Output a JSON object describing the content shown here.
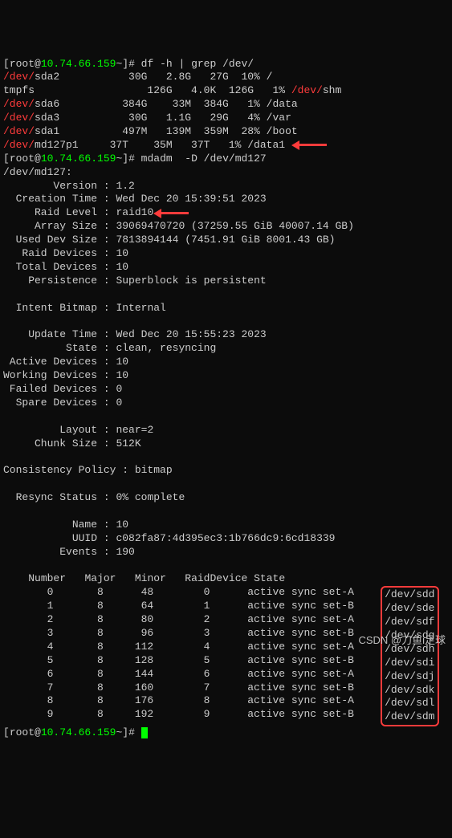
{
  "prompt": {
    "userhost": "root@",
    "ip": "10.74.66.159",
    "tilde": "~"
  },
  "cmd1": "df -h | grep /dev/",
  "df": [
    {
      "dev": "/dev/",
      "name": "sda2",
      "size": "30G",
      "used": "2.8G",
      "avail": "27G",
      "pct": "10%",
      "mount": "/"
    },
    {
      "dev": "",
      "name": "tmpfs",
      "size": "126G",
      "used": "4.0K",
      "avail": "126G",
      "pct": "1%",
      "mount_dev": "/dev/",
      "mount_rest": "shm"
    },
    {
      "dev": "/dev/",
      "name": "sda6",
      "size": "384G",
      "used": "33M",
      "avail": "384G",
      "pct": "1%",
      "mount": "/data"
    },
    {
      "dev": "/dev/",
      "name": "sda3",
      "size": "30G",
      "used": "1.1G",
      "avail": "29G",
      "pct": "4%",
      "mount": "/var"
    },
    {
      "dev": "/dev/",
      "name": "sda1",
      "size": "497M",
      "used": "139M",
      "avail": "359M",
      "pct": "28%",
      "mount": "/boot"
    },
    {
      "dev": "/dev/",
      "name": "md127p1",
      "size": "37T",
      "used": "35M",
      "avail": "37T",
      "pct": "1%",
      "mount": "/data1"
    }
  ],
  "cmd2": "mdadm  -D /dev/md127",
  "mdheader": "/dev/md127:",
  "md": {
    "Version": "1.2",
    "CreationTime": "Wed Dec 20 15:39:51 2023",
    "RaidLevel": "raid10",
    "ArraySize": "39069470720 (37259.55 GiB 40007.14 GB)",
    "UsedDevSize": "7813894144 (7451.91 GiB 8001.43 GB)",
    "RaidDevices": "10",
    "TotalDevices": "10",
    "Persistence": "Superblock is persistent",
    "IntentBitmap": "Internal",
    "UpdateTime": "Wed Dec 20 15:55:23 2023",
    "State": "clean, resyncing",
    "ActiveDevices": "10",
    "WorkingDevices": "10",
    "FailedDevices": "0",
    "SpareDevices": "0",
    "Layout": "near=2",
    "ChunkSize": "512K",
    "ConsistencyPolicy": "bitmap",
    "ResyncStatus": "0% complete",
    "Name": "10",
    "UUID": "c082fa87:4d395ec3:1b766dc9:6cd18339",
    "Events": "190"
  },
  "tblhdr": {
    "a": "Number",
    "b": "Major",
    "c": "Minor",
    "d": "RaidDevice",
    "e": "State"
  },
  "devices": [
    {
      "num": "0",
      "maj": "8",
      "min": "48",
      "rd": "0",
      "state": "active sync set-A",
      "path": "/dev/sdd"
    },
    {
      "num": "1",
      "maj": "8",
      "min": "64",
      "rd": "1",
      "state": "active sync set-B",
      "path": "/dev/sde"
    },
    {
      "num": "2",
      "maj": "8",
      "min": "80",
      "rd": "2",
      "state": "active sync set-A",
      "path": "/dev/sdf"
    },
    {
      "num": "3",
      "maj": "8",
      "min": "96",
      "rd": "3",
      "state": "active sync set-B",
      "path": "/dev/sdg"
    },
    {
      "num": "4",
      "maj": "8",
      "min": "112",
      "rd": "4",
      "state": "active sync set-A",
      "path": "/dev/sdh"
    },
    {
      "num": "5",
      "maj": "8",
      "min": "128",
      "rd": "5",
      "state": "active sync set-B",
      "path": "/dev/sdi"
    },
    {
      "num": "6",
      "maj": "8",
      "min": "144",
      "rd": "6",
      "state": "active sync set-A",
      "path": "/dev/sdj"
    },
    {
      "num": "7",
      "maj": "8",
      "min": "160",
      "rd": "7",
      "state": "active sync set-B",
      "path": "/dev/sdk"
    },
    {
      "num": "8",
      "maj": "8",
      "min": "176",
      "rd": "8",
      "state": "active sync set-A",
      "path": "/dev/sdl"
    },
    {
      "num": "9",
      "maj": "8",
      "min": "192",
      "rd": "9",
      "state": "active sync set-B",
      "path": "/dev/sdm"
    }
  ],
  "watermark": "CSDN @刀鱼i足球"
}
